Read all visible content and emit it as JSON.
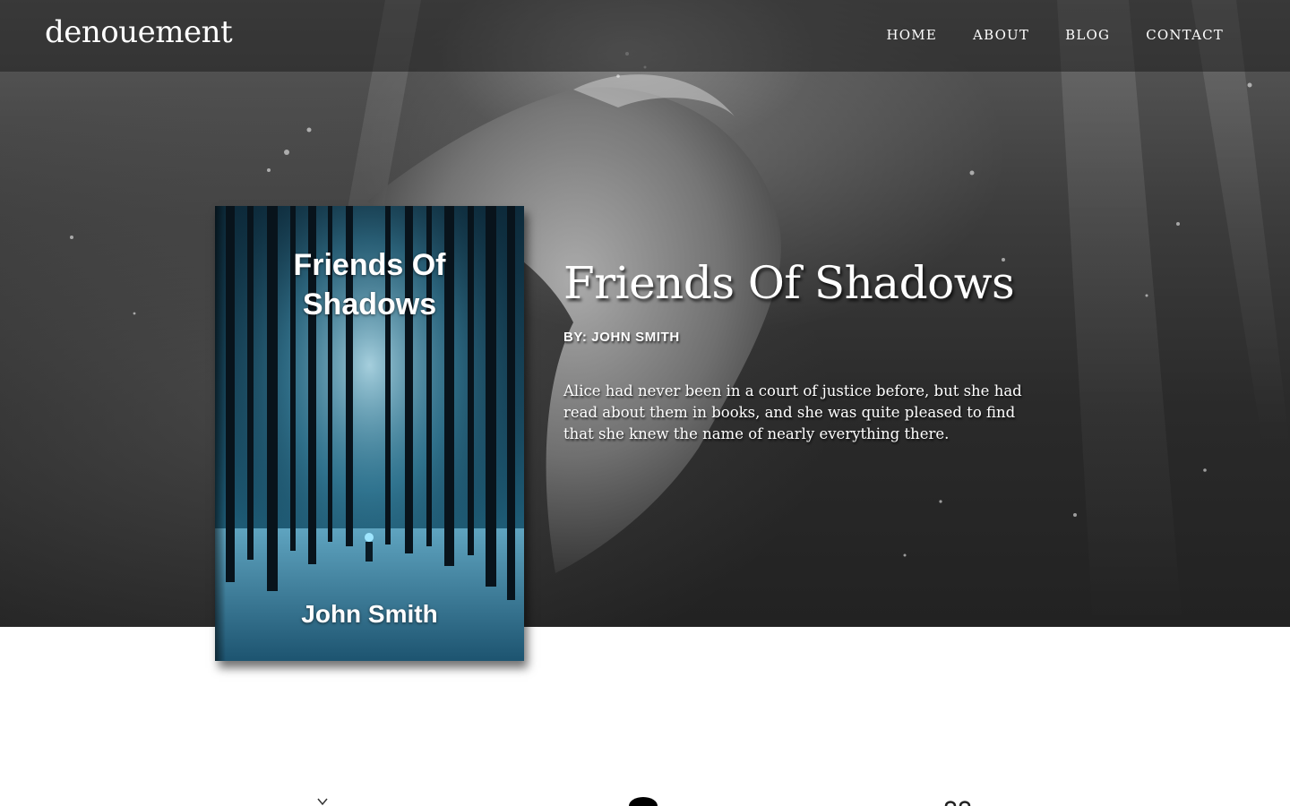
{
  "site": {
    "brand": "denouement"
  },
  "nav": {
    "items": [
      {
        "label": "HOME"
      },
      {
        "label": "ABOUT"
      },
      {
        "label": "BLOG"
      },
      {
        "label": "CONTACT"
      }
    ]
  },
  "book": {
    "cover_title": "Friends Of Shadows",
    "cover_author": "John Smith"
  },
  "hero": {
    "title": "Friends Of Shadows",
    "byline": "BY: JOHN SMITH",
    "blurb": "Alice had never been in a court of justice before, but she had read about them in books, and she was quite pleased to find that she knew the name of nearly everything there."
  },
  "icons": [
    "sprout-icon",
    "person-icon",
    "glasses-icon"
  ],
  "colors": {
    "cover_accent": "#2b7393",
    "nav_bg": "#1e1e1e",
    "text": "#ffffff"
  }
}
